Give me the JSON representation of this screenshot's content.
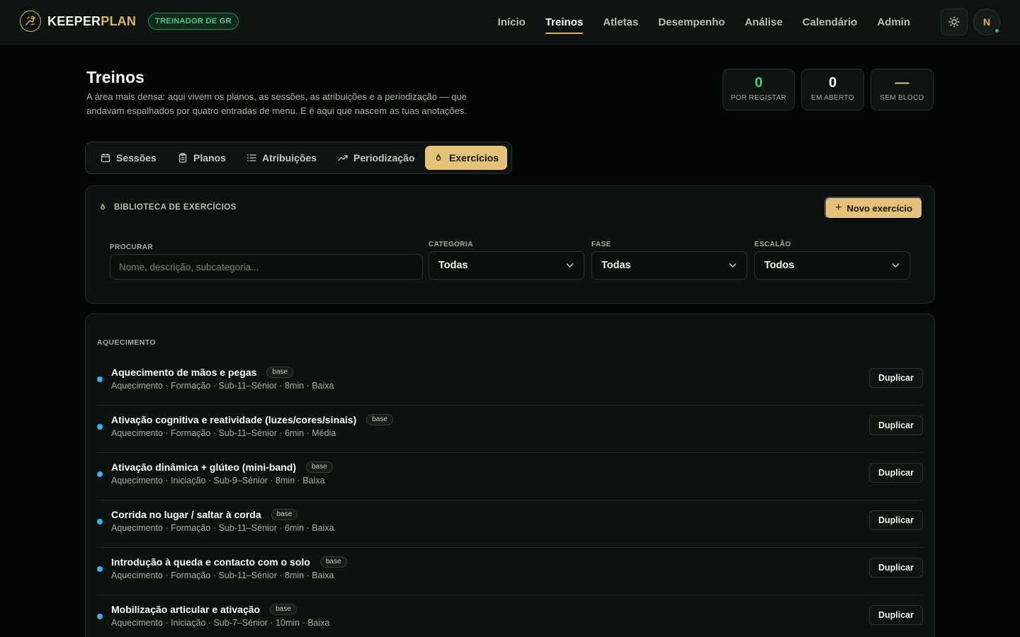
{
  "brand": {
    "name_primary": "KEEPER",
    "name_accent": "PLAN",
    "role": "TREINADOR DE GR"
  },
  "nav": {
    "items": [
      {
        "label": "Início",
        "active": false
      },
      {
        "label": "Treinos",
        "active": true
      },
      {
        "label": "Atletas",
        "active": false
      },
      {
        "label": "Desempenho",
        "active": false
      },
      {
        "label": "Análise",
        "active": false
      },
      {
        "label": "Calendário",
        "active": false
      },
      {
        "label": "Admin",
        "active": false
      }
    ]
  },
  "user": {
    "initial": "N",
    "online": true
  },
  "page": {
    "title": "Treinos",
    "description": "A área mais densa: aqui vivem os planos, as sessões, as atribuições e a periodização — que andavam espalhados por quatro entradas de menu. E é aqui que nascem as tuas anotações."
  },
  "stats": [
    {
      "value": "0",
      "label": "POR REGISTAR",
      "color": "#3fcf7f"
    },
    {
      "value": "0",
      "label": "EM ABERTO",
      "color": "#ffffff"
    },
    {
      "value": "—",
      "label": "SEM BLOCO",
      "color": "#e5c27a"
    }
  ],
  "tabs": [
    {
      "label": "Sessões",
      "icon": "calendar-icon",
      "active": false
    },
    {
      "label": "Planos",
      "icon": "clipboard-icon",
      "active": false
    },
    {
      "label": "Atribuições",
      "icon": "list-icon",
      "active": false
    },
    {
      "label": "Periodização",
      "icon": "trend-up-icon",
      "active": false
    },
    {
      "label": "Exercícios",
      "icon": "flame-icon",
      "active": true
    }
  ],
  "library": {
    "title": "BIBLIOTECA DE EXERCÍCIOS",
    "new_button": "Novo exercício",
    "filters": {
      "search_label": "PROCURAR",
      "search_placeholder": "Nome, descrição, subcategoria...",
      "search_value": "",
      "category_label": "CATEGORIA",
      "category_value": "Todas",
      "phase_label": "FASE",
      "phase_value": "Todas",
      "level_label": "ESCALÃO",
      "level_value": "Todos"
    }
  },
  "exercises": {
    "group": "AQUECIMENTO",
    "duplicate_label": "Duplicar",
    "items": [
      {
        "title": "Aquecimento de mãos e pegas",
        "badge": "base",
        "meta": "Aquecimento · Formação · Sub-11–Sénior · 8min · Baixa"
      },
      {
        "title": "Ativação cognitiva e reatividade (luzes/cores/sinais)",
        "badge": "base",
        "meta": "Aquecimento · Formação · Sub-11–Sénior · 6min · Média"
      },
      {
        "title": "Ativação dinâmica + glúteo (mini-band)",
        "badge": "base",
        "meta": "Aquecimento · Iniciação · Sub-9–Sénior · 8min · Baixa"
      },
      {
        "title": "Corrida no lugar / saltar à corda",
        "badge": "base",
        "meta": "Aquecimento · Formação · Sub-11–Sénior · 6min · Baixa"
      },
      {
        "title": "Introdução à queda e contacto com o solo",
        "badge": "base",
        "meta": "Aquecimento · Formação · Sub-11–Sénior · 8min · Baixa"
      },
      {
        "title": "Mobilização articular e ativação",
        "badge": "base",
        "meta": "Aquecimento · Iniciação · Sub-7–Sénior · 10min · Baixa"
      }
    ]
  },
  "colors": {
    "accent": "#e5c27a",
    "success": "#3fcf7f",
    "dot": "#3bb3ea",
    "background": "#040604"
  }
}
